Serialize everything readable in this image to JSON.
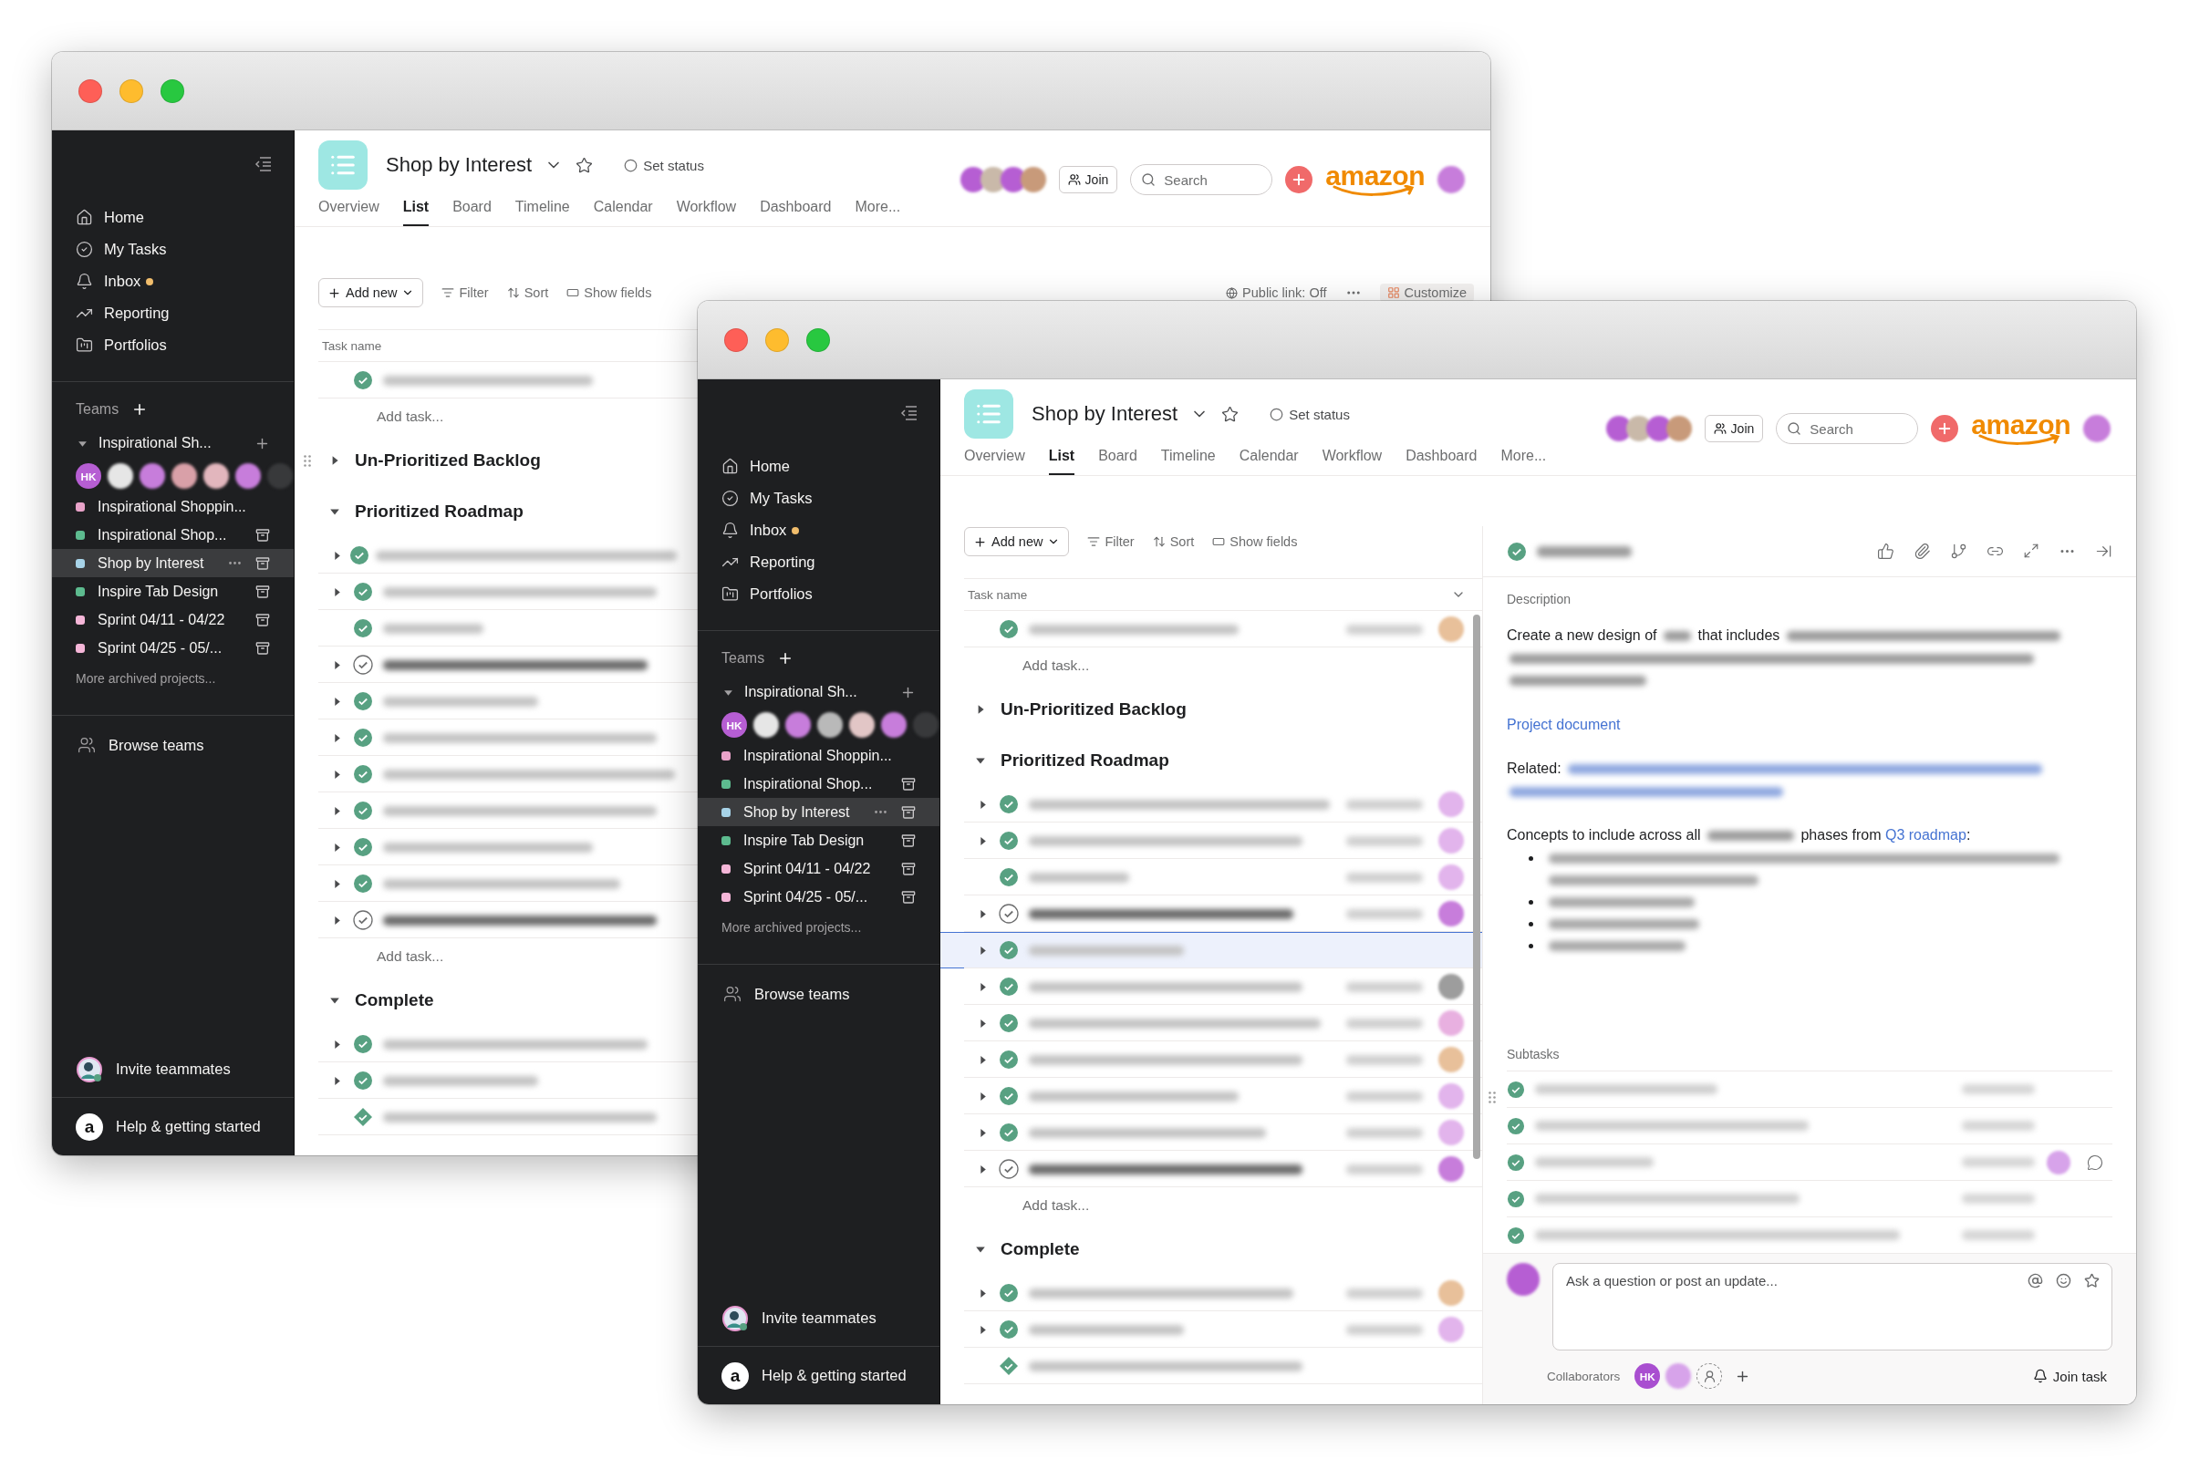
{
  "windows": [
    {
      "kind": "back",
      "sidebar": {
        "nav": [
          {
            "label": "Home",
            "unread": false
          },
          {
            "label": "My Tasks",
            "unread": false
          },
          {
            "label": "Inbox",
            "unread": true
          },
          {
            "label": "Reporting",
            "unread": false
          },
          {
            "label": "Portfolios",
            "unread": false
          }
        ],
        "teams_label": "Teams",
        "team": {
          "name": "Inspirational Sh...",
          "expanded": true
        },
        "members": [
          {
            "initials": "HK",
            "color": "#b65ed3"
          },
          {
            "color": "#e6e6e6"
          },
          {
            "color": "#c77ddb"
          },
          {
            "color": "#d9a0a8"
          },
          {
            "color": "#e2b6bd"
          },
          {
            "color": "#c77ddb"
          },
          {
            "color": "#38393b"
          }
        ],
        "projects": [
          {
            "name": "Inspirational Shoppin...",
            "color": "#e9a3c9",
            "selected": false,
            "archived": false
          },
          {
            "name": "Inspirational Shop...",
            "color": "#5dbb8f",
            "selected": false,
            "archived": true
          },
          {
            "name": "Shop by Interest",
            "color": "#a7d3e8",
            "selected": true,
            "archived": true
          },
          {
            "name": "Inspire Tab Design",
            "color": "#5dbb8f",
            "selected": false,
            "archived": true
          },
          {
            "name": "Sprint 04/11 - 04/22",
            "color": "#f5b6d8",
            "selected": false,
            "archived": true
          },
          {
            "name": "Sprint 04/25 - 05/...",
            "color": "#f5b6d8",
            "selected": false,
            "archived": true
          }
        ],
        "more": "More archived projects...",
        "browse": "Browse teams",
        "invite": "Invite teammates",
        "workspace_initial": "a",
        "help": "Help & getting started"
      },
      "header": {
        "title": "Shop by Interest",
        "status": "Set status",
        "tabs": [
          {
            "label": "Overview",
            "selected": false
          },
          {
            "label": "List",
            "selected": true
          },
          {
            "label": "Board",
            "selected": false
          },
          {
            "label": "Timeline",
            "selected": false
          },
          {
            "label": "Calendar",
            "selected": false
          },
          {
            "label": "Workflow",
            "selected": false
          },
          {
            "label": "Dashboard",
            "selected": false
          },
          {
            "label": "More...",
            "selected": false
          }
        ],
        "viewers": [
          {
            "color": "#b65ed3"
          },
          {
            "color": "#c9b9a9"
          },
          {
            "color": "#b65ed3"
          },
          {
            "color": "#c89a7a"
          }
        ],
        "join": "Join",
        "search": {
          "placeholder": "Search"
        },
        "brand": "amazon",
        "user": {
          "color": "#c77ddb"
        }
      },
      "toolbar": {
        "add_new": "Add new",
        "filter": "Filter",
        "sort": "Sort",
        "show_fields": "Show fields",
        "public_link": "Public link: Off",
        "customize": "Customize"
      },
      "list": {
        "column": {
          "label": "Task name"
        },
        "sections": [
          {
            "rows": [
              {
                "kind": "task",
                "done": true,
                "subtasks": false,
                "selected": false
              }
            ],
            "add_task": "Add task..."
          },
          {
            "title": "Un-Prioritized Backlog",
            "expanded": false,
            "handle": true
          },
          {
            "title": "Prioritized Roadmap",
            "expanded": true,
            "rows": [
              {
                "kind": "task",
                "done": true,
                "subtasks": true,
                "selected": false
              },
              {
                "kind": "task",
                "done": true,
                "subtasks": true,
                "selected": false
              },
              {
                "kind": "task",
                "done": true,
                "subtasks": false,
                "selected": false
              },
              {
                "kind": "task",
                "done": false,
                "subtasks": true,
                "selected": false
              },
              {
                "kind": "task",
                "done": true,
                "subtasks": true,
                "selected": false
              },
              {
                "kind": "task",
                "done": true,
                "subtasks": true,
                "selected": false
              },
              {
                "kind": "task",
                "done": true,
                "subtasks": true,
                "selected": false
              },
              {
                "kind": "task",
                "done": true,
                "subtasks": true,
                "selected": false
              },
              {
                "kind": "task",
                "done": true,
                "subtasks": true,
                "selected": false
              },
              {
                "kind": "task",
                "done": true,
                "subtasks": true,
                "selected": false
              },
              {
                "kind": "task",
                "done": false,
                "subtasks": true,
                "selected": false
              }
            ],
            "add_task": "Add task..."
          },
          {
            "title": "Complete",
            "expanded": true,
            "rows": [
              {
                "kind": "task",
                "done": true,
                "subtasks": true,
                "selected": false
              },
              {
                "kind": "task",
                "done": true,
                "subtasks": true,
                "selected": false
              },
              {
                "kind": "milestone",
                "done": true,
                "subtasks": false,
                "selected": false
              }
            ]
          }
        ]
      }
    },
    {
      "kind": "front",
      "sidebar": {
        "nav": [
          {
            "label": "Home",
            "unread": false
          },
          {
            "label": "My Tasks",
            "unread": false
          },
          {
            "label": "Inbox",
            "unread": true
          },
          {
            "label": "Reporting",
            "unread": false
          },
          {
            "label": "Portfolios",
            "unread": false
          }
        ],
        "teams_label": "Teams",
        "team": {
          "name": "Inspirational Sh...",
          "expanded": true
        },
        "members": [
          {
            "initials": "HK",
            "color": "#b65ed3"
          },
          {
            "color": "#e6e6e6"
          },
          {
            "color": "#c77ddb"
          },
          {
            "color": "#b9b9b9"
          },
          {
            "color": "#e2c6c6"
          },
          {
            "color": "#c77ddb"
          },
          {
            "color": "#38393b"
          }
        ],
        "projects": [
          {
            "name": "Inspirational Shoppin...",
            "color": "#e9a3c9",
            "selected": false,
            "archived": false
          },
          {
            "name": "Inspirational Shop...",
            "color": "#5dbb8f",
            "selected": false,
            "archived": true
          },
          {
            "name": "Shop by Interest",
            "color": "#a7d3e8",
            "selected": true,
            "archived": true
          },
          {
            "name": "Inspire Tab Design",
            "color": "#5dbb8f",
            "selected": false,
            "archived": true
          },
          {
            "name": "Sprint 04/11 - 04/22",
            "color": "#f5b6d8",
            "selected": false,
            "archived": true
          },
          {
            "name": "Sprint 04/25 - 05/...",
            "color": "#f5b6d8",
            "selected": false,
            "archived": true
          }
        ],
        "more": "More archived projects...",
        "browse": "Browse teams",
        "invite": "Invite teammates",
        "workspace_initial": "a",
        "help": "Help & getting started"
      },
      "header": {
        "title": "Shop by Interest",
        "status": "Set status",
        "tabs": [
          {
            "label": "Overview",
            "selected": false
          },
          {
            "label": "List",
            "selected": true
          },
          {
            "label": "Board",
            "selected": false
          },
          {
            "label": "Timeline",
            "selected": false
          },
          {
            "label": "Calendar",
            "selected": false
          },
          {
            "label": "Workflow",
            "selected": false
          },
          {
            "label": "Dashboard",
            "selected": false
          },
          {
            "label": "More...",
            "selected": false
          }
        ],
        "viewers": [
          {
            "color": "#b65ed3"
          },
          {
            "color": "#c9b9a9"
          },
          {
            "color": "#b65ed3"
          },
          {
            "color": "#c89a7a"
          }
        ],
        "join": "Join",
        "search": {
          "placeholder": "Search"
        },
        "brand": "amazon",
        "user": {
          "color": "#c77ddb"
        }
      },
      "toolbar": {
        "add_new": "Add new",
        "filter": "Filter",
        "sort": "Sort",
        "show_fields": "Show fields"
      },
      "list": {
        "column": {
          "label": "Task name",
          "menu": true
        },
        "sections": [
          {
            "rows": [
              {
                "kind": "task",
                "done": true,
                "subtasks": false,
                "selected": false,
                "color": "#e8c09a"
              }
            ],
            "add_task": "Add task..."
          },
          {
            "title": "Un-Prioritized Backlog",
            "expanded": false
          },
          {
            "title": "Prioritized Roadmap",
            "expanded": true,
            "rows": [
              {
                "kind": "task",
                "done": true,
                "subtasks": true,
                "selected": false,
                "color": "#e2b4ec"
              },
              {
                "kind": "task",
                "done": true,
                "subtasks": true,
                "selected": false,
                "color": "#e2b4ec"
              },
              {
                "kind": "task",
                "done": true,
                "subtasks": false,
                "selected": false,
                "color": "#e2b4ec"
              },
              {
                "kind": "task",
                "done": false,
                "subtasks": true,
                "selected": false,
                "color": "#c77ddb"
              },
              {
                "kind": "task",
                "done": true,
                "subtasks": true,
                "selected": true
              },
              {
                "kind": "task",
                "done": true,
                "subtasks": true,
                "selected": false,
                "color": "#9d9d9d"
              },
              {
                "kind": "task",
                "done": true,
                "subtasks": true,
                "selected": false,
                "color": "#e8b0e0"
              },
              {
                "kind": "task",
                "done": true,
                "subtasks": true,
                "selected": false,
                "color": "#e8c09a"
              },
              {
                "kind": "task",
                "done": true,
                "subtasks": true,
                "selected": false,
                "color": "#e2b4ec"
              },
              {
                "kind": "task",
                "done": true,
                "subtasks": true,
                "selected": false,
                "color": "#e2b4ec"
              },
              {
                "kind": "task",
                "done": false,
                "subtasks": true,
                "selected": false,
                "color": "#c77ddb"
              }
            ],
            "add_task": "Add task..."
          },
          {
            "title": "Complete",
            "expanded": true,
            "rows": [
              {
                "kind": "task",
                "done": true,
                "subtasks": true,
                "selected": false,
                "color": "#e8c09a"
              },
              {
                "kind": "task",
                "done": true,
                "subtasks": true,
                "selected": false,
                "color": "#e2b4ec"
              },
              {
                "kind": "milestone",
                "done": true,
                "subtasks": false,
                "selected": false
              }
            ]
          }
        ]
      },
      "detail": {
        "done": true,
        "handle": true,
        "description_label": "Description",
        "description": [
          {
            "kind": "text",
            "text": "Create a new design of "
          },
          {
            "kind": "blurred"
          },
          {
            "kind": "text",
            "text": " that includes "
          },
          {
            "kind": "blurred"
          },
          {
            "kind": "blurred"
          },
          {
            "kind": "blurred"
          }
        ],
        "link": "Project document",
        "related": [
          {
            "kind": "text",
            "text": "Related: "
          },
          {
            "kind": "blurred_link"
          },
          {
            "kind": "blurred_link"
          }
        ],
        "concepts": [
          {
            "kind": "text",
            "text": "Concepts to include across all "
          },
          {
            "kind": "blurred"
          },
          {
            "kind": "text",
            "text": " phases from "
          },
          {
            "kind": "link",
            "text": "Q3 roadmap"
          },
          {
            "kind": "text",
            "text": ":"
          }
        ],
        "bullets": [
          [
            {
              "kind": "blurred"
            },
            {
              "kind": "blurred"
            }
          ],
          [
            {
              "kind": "blurred"
            }
          ],
          [
            {
              "kind": "blurred"
            }
          ],
          [
            {
              "kind": "blurred"
            }
          ]
        ],
        "subtasks_label": "Subtasks",
        "subtasks": [
          {
            "done": true,
            "comments": false
          },
          {
            "done": true,
            "comments": false
          },
          {
            "done": true,
            "comments": true,
            "color": "#d7a3ea"
          },
          {
            "done": true,
            "comments": false
          },
          {
            "done": true,
            "comments": false
          }
        ],
        "composer": {
          "placeholder": "Ask a question or post an update...",
          "avatar": {
            "color": "#b65ed3"
          }
        },
        "collaborators_label": "Collaborators",
        "collaborators": [
          {
            "initials": "HK",
            "color": "#a94fd0"
          },
          {
            "color": "#d7a3ea"
          }
        ],
        "join_task": "Join task"
      }
    }
  ]
}
